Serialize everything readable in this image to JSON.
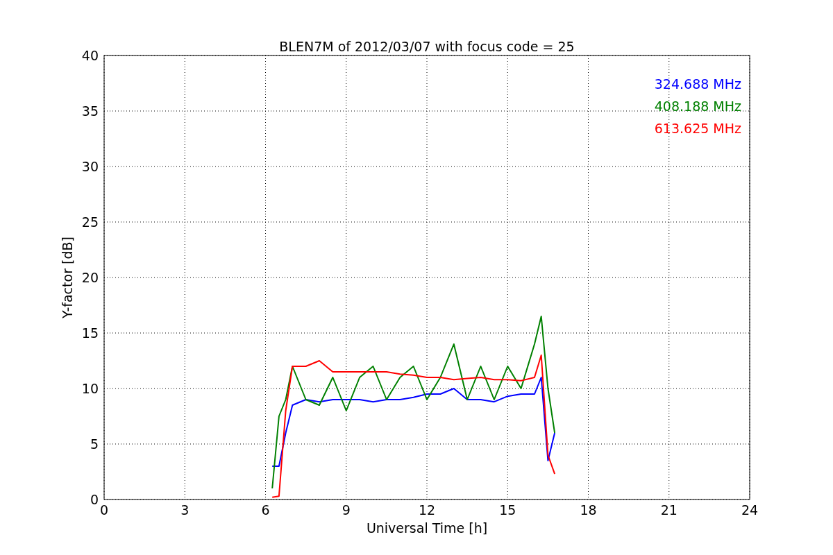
{
  "chart_data": {
    "type": "line",
    "title": "BLEN7M of 2012/03/07 with focus code = 25",
    "xlabel": "Universal Time [h]",
    "ylabel": "Y-factor [dB]",
    "x": [
      6.25,
      6.5,
      6.75,
      7,
      7.5,
      8,
      8.5,
      9,
      9.5,
      10,
      10.5,
      11,
      11.5,
      12,
      12.5,
      13,
      13.5,
      14,
      14.5,
      15,
      15.5,
      16,
      16.25,
      16.5,
      16.75
    ],
    "series": [
      {
        "name": "324.688 MHz",
        "color": "#0000ff",
        "values": [
          3,
          3,
          6,
          8.5,
          9,
          8.8,
          9,
          9,
          9,
          8.8,
          9,
          9,
          9.2,
          9.5,
          9.5,
          10,
          9,
          9,
          8.8,
          9.3,
          9.5,
          9.5,
          11,
          3.5,
          6
        ]
      },
      {
        "name": "408.188 MHz",
        "color": "#008000",
        "values": [
          1,
          7.5,
          9,
          12,
          9,
          8.5,
          11,
          8,
          11,
          12,
          9,
          11,
          12,
          9,
          11,
          14,
          9,
          12,
          9,
          12,
          10,
          14,
          16.5,
          10,
          6
        ]
      },
      {
        "name": "613.625 MHz",
        "color": "#ff0000",
        "values": [
          0.2,
          0.3,
          8,
          12,
          12,
          12.5,
          11.5,
          11.5,
          11.5,
          11.5,
          11.5,
          11.3,
          11.2,
          11,
          11,
          10.8,
          10.9,
          11,
          10.8,
          10.8,
          10.7,
          11,
          13,
          4,
          2.3
        ]
      }
    ],
    "xlim": [
      0,
      24
    ],
    "ylim": [
      0,
      40
    ],
    "xticks": [
      0,
      3,
      6,
      9,
      12,
      15,
      18,
      21,
      24
    ],
    "yticks": [
      0,
      5,
      10,
      15,
      20,
      25,
      30,
      35,
      40
    ],
    "grid": true
  }
}
